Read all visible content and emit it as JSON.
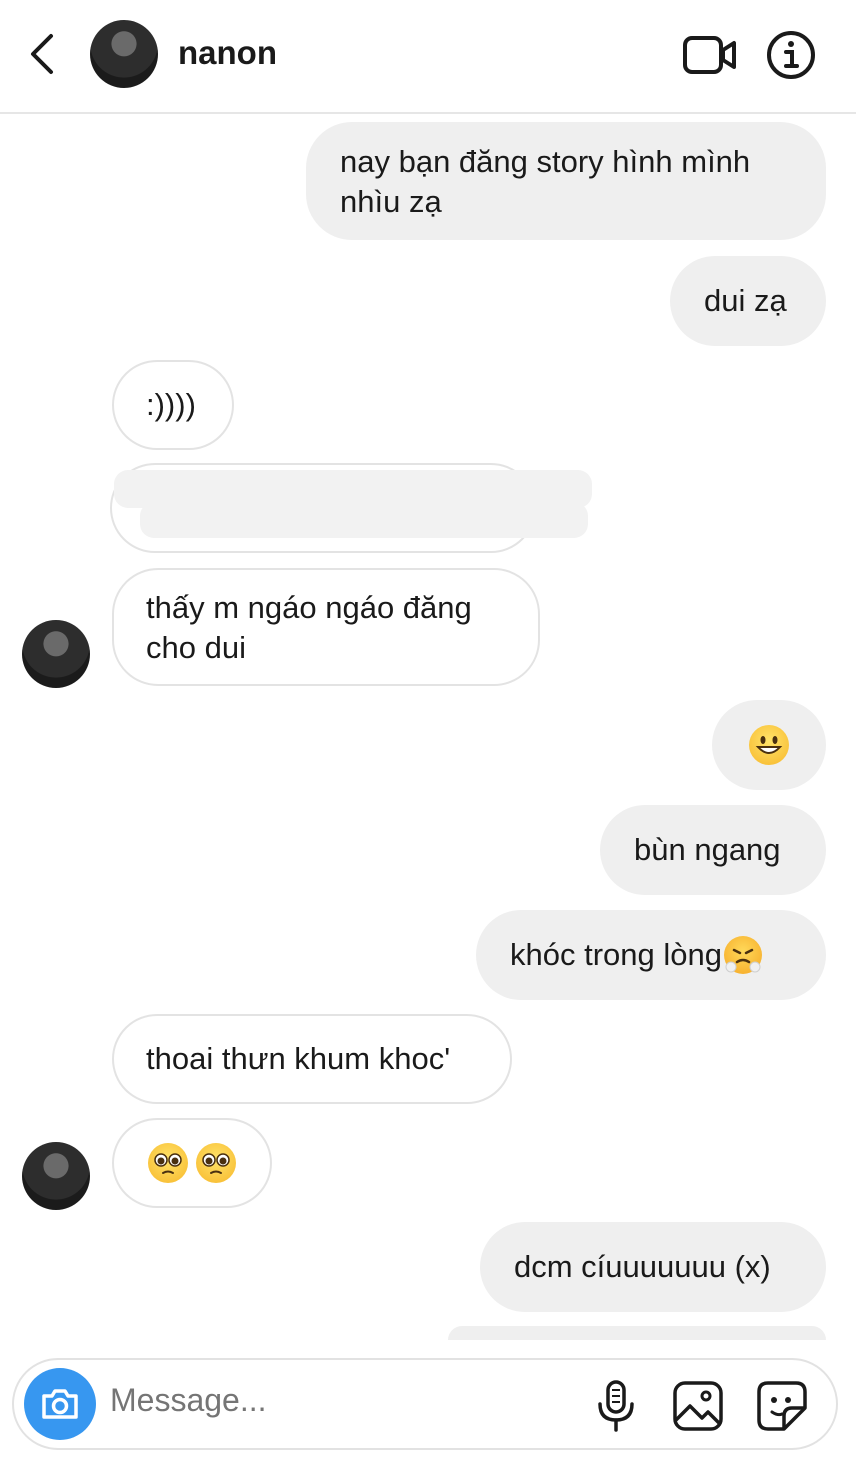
{
  "header": {
    "contact_name": "nanon",
    "back_icon": "chevron-left-icon",
    "video_icon": "video-camera-icon",
    "info_icon": "info-icon"
  },
  "messages": [
    {
      "direction": "outgoing",
      "text": "nay bạn đăng story hình mình\nnhìu zạ"
    },
    {
      "direction": "outgoing",
      "text": "dui zạ"
    },
    {
      "direction": "incoming",
      "text": ":))))"
    },
    {
      "direction": "incoming",
      "text": "",
      "redacted": true
    },
    {
      "direction": "incoming",
      "text": "thấy m ngáo ngáo đăng\ncho dui"
    },
    {
      "direction": "outgoing",
      "text": "",
      "emoji": "grinning-face-emoji"
    },
    {
      "direction": "outgoing",
      "text": "bùn ngang"
    },
    {
      "direction": "outgoing",
      "text": "khóc trong lòng",
      "emoji": "steam-face-emoji"
    },
    {
      "direction": "incoming",
      "text": "thoai thưn khum khoc'"
    },
    {
      "direction": "incoming",
      "text": "",
      "emoji": "pleading-face-emoji x2"
    },
    {
      "direction": "outgoing",
      "text": "dcm cíuuuuuuu (x)"
    }
  ],
  "composer": {
    "placeholder": "Message...",
    "camera_icon": "camera-icon",
    "mic_icon": "microphone-icon",
    "gallery_icon": "image-icon",
    "sticker_icon": "sticker-icon"
  },
  "colors": {
    "accent": "#3797f0",
    "outgoing_bubble": "#efefef",
    "incoming_border": "#e3e3e3"
  }
}
